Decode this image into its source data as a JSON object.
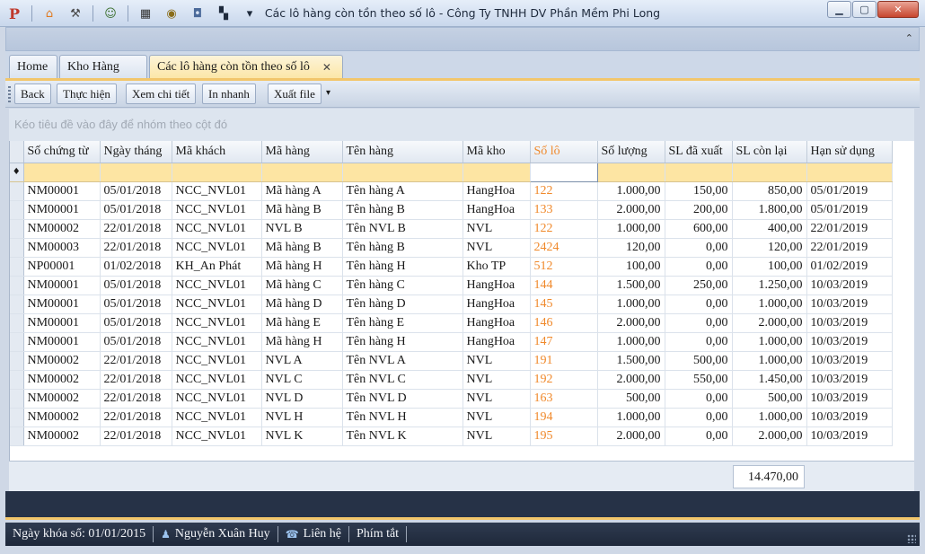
{
  "window": {
    "title": "Các lô hàng còn tồn theo số lô - Công Ty TNHH DV Phần Mềm Phi Long",
    "minimize": "▁",
    "maximize": "▢",
    "close": "✕",
    "ribbon_collapse": "⌃"
  },
  "quick_access": [
    {
      "name": "app-logo-icon",
      "glyph": "P",
      "color": "#c0392b"
    },
    {
      "name": "home-icon",
      "glyph": "⌂",
      "color": "#e07a1f"
    },
    {
      "name": "tools-icon",
      "glyph": "⚒",
      "color": "#4a4a4a"
    },
    {
      "name": "people-icon",
      "glyph": "☺",
      "color": "#3b6f2c"
    },
    {
      "name": "film-icon",
      "glyph": "▦",
      "color": "#333333"
    },
    {
      "name": "eye-icon",
      "glyph": "◉",
      "color": "#8a6d1a"
    },
    {
      "name": "camera-icon",
      "glyph": "◘",
      "color": "#4b6a9a"
    },
    {
      "name": "checker-icon",
      "glyph": "▚",
      "color": "#1e2a3c"
    },
    {
      "name": "dropdown-arrow-icon",
      "glyph": "▾",
      "color": "#1e2a3c"
    }
  ],
  "tabs": [
    {
      "label": "Home",
      "active": false
    },
    {
      "label": "Kho Hàng",
      "active": false
    },
    {
      "label": "Các lô hàng còn tồn theo số lô",
      "active": true,
      "close": "✕"
    }
  ],
  "toolbar": {
    "back": "Back",
    "execute": "Thực hiện",
    "view_detail": "Xem chi tiết",
    "quick_print": "In nhanh",
    "export_file": "Xuất file",
    "more": "▾"
  },
  "group_panel": {
    "hint": "Kéo tiêu đề vào đây để nhóm theo cột đó"
  },
  "grid": {
    "filter_indicator": "♦",
    "columns": [
      "Số chứng từ",
      "Ngày tháng",
      "Mã khách",
      "Mã hàng",
      "Tên hàng",
      "Mã kho",
      "Số lô",
      "Số lượng",
      "SL đã xuất",
      "SL còn lại",
      "Hạn sử dụng"
    ],
    "rows": [
      [
        "NM00001",
        "05/01/2018",
        "NCC_NVL01",
        "Mã hàng A",
        "Tên hàng A",
        "HangHoa",
        "122",
        "1.000,00",
        "150,00",
        "850,00",
        "05/01/2019"
      ],
      [
        "NM00001",
        "05/01/2018",
        "NCC_NVL01",
        "Mã hàng B",
        "Tên hàng B",
        "HangHoa",
        "133",
        "2.000,00",
        "200,00",
        "1.800,00",
        "05/01/2019"
      ],
      [
        "NM00002",
        "22/01/2018",
        "NCC_NVL01",
        "NVL B",
        "Tên NVL B",
        "NVL",
        "122",
        "1.000,00",
        "600,00",
        "400,00",
        "22/01/2019"
      ],
      [
        "NM00003",
        "22/01/2018",
        "NCC_NVL01",
        "Mã hàng B",
        "Tên hàng B",
        "NVL",
        "2424",
        "120,00",
        "0,00",
        "120,00",
        "22/01/2019"
      ],
      [
        "NP00001",
        "01/02/2018",
        "KH_An Phát",
        "Mã hàng H",
        "Tên hàng H",
        "Kho TP",
        "512",
        "100,00",
        "0,00",
        "100,00",
        "01/02/2019"
      ],
      [
        "NM00001",
        "05/01/2018",
        "NCC_NVL01",
        "Mã hàng C",
        "Tên hàng C",
        "HangHoa",
        "144",
        "1.500,00",
        "250,00",
        "1.250,00",
        "10/03/2019"
      ],
      [
        "NM00001",
        "05/01/2018",
        "NCC_NVL01",
        "Mã hàng D",
        "Tên hàng D",
        "HangHoa",
        "145",
        "1.000,00",
        "0,00",
        "1.000,00",
        "10/03/2019"
      ],
      [
        "NM00001",
        "05/01/2018",
        "NCC_NVL01",
        "Mã hàng E",
        "Tên hàng E",
        "HangHoa",
        "146",
        "2.000,00",
        "0,00",
        "2.000,00",
        "10/03/2019"
      ],
      [
        "NM00001",
        "05/01/2018",
        "NCC_NVL01",
        "Mã hàng H",
        "Tên hàng H",
        "HangHoa",
        "147",
        "1.000,00",
        "0,00",
        "1.000,00",
        "10/03/2019"
      ],
      [
        "NM00002",
        "22/01/2018",
        "NCC_NVL01",
        "NVL A",
        "Tên NVL A",
        "NVL",
        "191",
        "1.500,00",
        "500,00",
        "1.000,00",
        "10/03/2019"
      ],
      [
        "NM00002",
        "22/01/2018",
        "NCC_NVL01",
        "NVL C",
        "Tên NVL C",
        "NVL",
        "192",
        "2.000,00",
        "550,00",
        "1.450,00",
        "10/03/2019"
      ],
      [
        "NM00002",
        "22/01/2018",
        "NCC_NVL01",
        "NVL D",
        "Tên NVL D",
        "NVL",
        "163",
        "500,00",
        "0,00",
        "500,00",
        "10/03/2019"
      ],
      [
        "NM00002",
        "22/01/2018",
        "NCC_NVL01",
        "NVL H",
        "Tên NVL H",
        "NVL",
        "194",
        "1.000,00",
        "0,00",
        "1.000,00",
        "10/03/2019"
      ],
      [
        "NM00002",
        "22/01/2018",
        "NCC_NVL01",
        "NVL K",
        "Tên NVL K",
        "NVL",
        "195",
        "2.000,00",
        "0,00",
        "2.000,00",
        "10/03/2019"
      ]
    ],
    "total_remaining": "14.470,00"
  },
  "status": {
    "lock_date": "Ngày khóa sổ: 01/01/2015",
    "user": "Nguyễn Xuân Huy",
    "contact": "Liên hệ",
    "shortcuts": "Phím tắt",
    "user_icon": "♟",
    "contact_icon": "☎"
  },
  "colors": {
    "accent_orange": "#f0892b",
    "filter_row": "#fde5a3",
    "active_tab": "#fbe6a6",
    "statusbar": "#1e283a"
  }
}
